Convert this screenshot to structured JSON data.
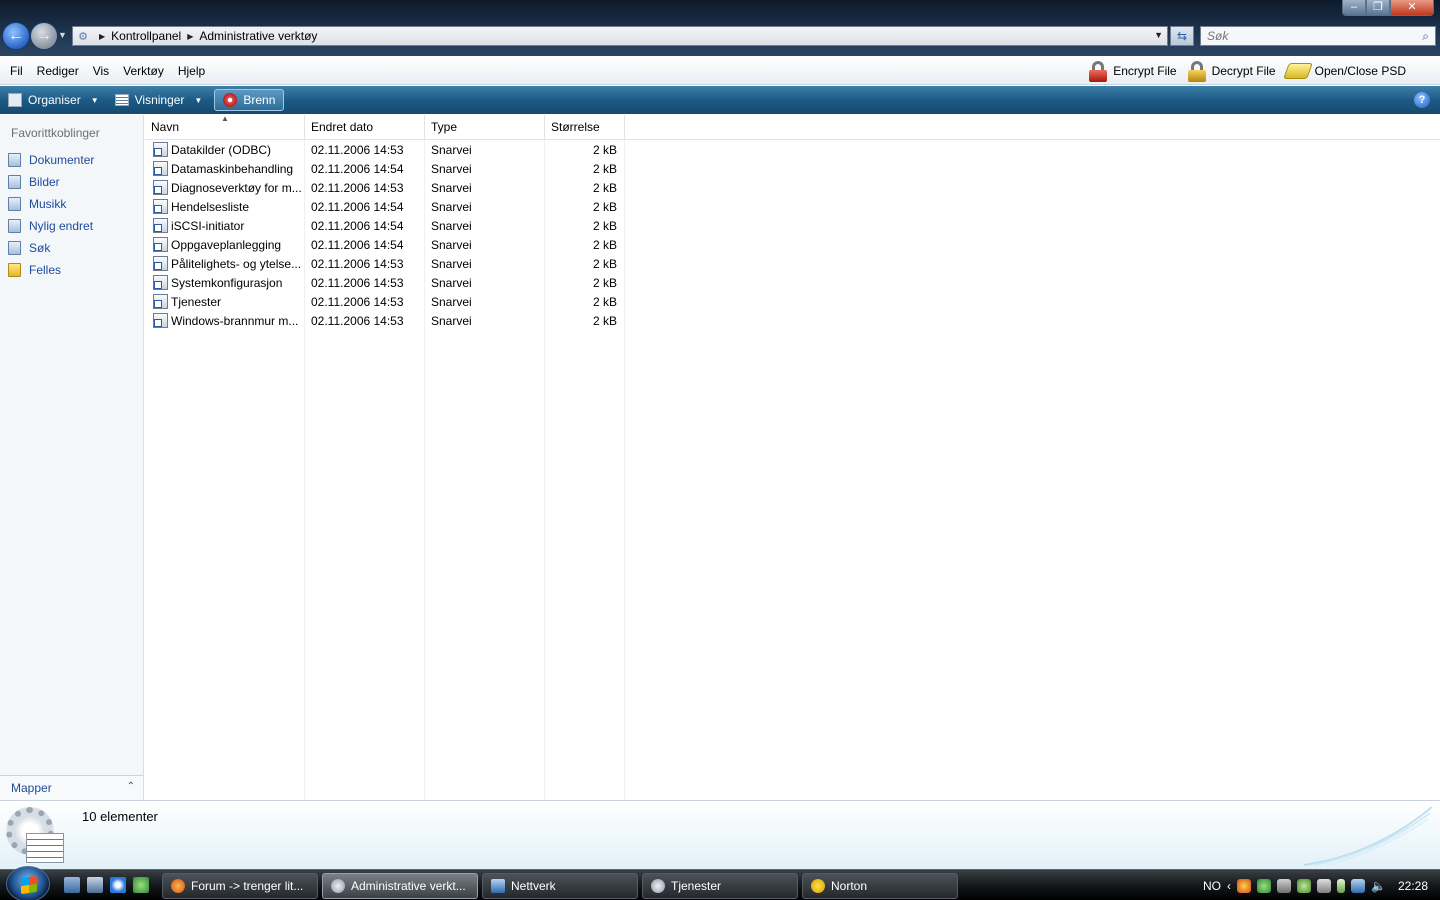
{
  "window": {
    "minimize": "‒",
    "maximize": "❐",
    "close": "✕"
  },
  "address": {
    "crumbs": [
      "Kontrollpanel",
      "Administrative verktøy"
    ]
  },
  "search": {
    "placeholder": "Søk"
  },
  "menu": {
    "items": [
      "Fil",
      "Rediger",
      "Vis",
      "Verktøy",
      "Hjelp"
    ],
    "tools": [
      "Encrypt File",
      "Decrypt File",
      "Open/Close PSD"
    ]
  },
  "commands": {
    "organise": "Organiser",
    "views": "Visninger",
    "burn": "Brenn"
  },
  "navpane": {
    "favorites_header": "Favorittkoblinger",
    "favorites": [
      "Dokumenter",
      "Bilder",
      "Musikk",
      "Nylig endret",
      "Søk",
      "Felles"
    ],
    "folders_label": "Mapper"
  },
  "columns": [
    "Navn",
    "Endret dato",
    "Type",
    "Størrelse"
  ],
  "files": [
    {
      "name": "Datakilder (ODBC)",
      "date": "02.11.2006 14:53",
      "type": "Snarvei",
      "size": "2 kB"
    },
    {
      "name": "Datamaskinbehandling",
      "date": "02.11.2006 14:54",
      "type": "Snarvei",
      "size": "2 kB"
    },
    {
      "name": "Diagnoseverktøy for m...",
      "date": "02.11.2006 14:53",
      "type": "Snarvei",
      "size": "2 kB"
    },
    {
      "name": "Hendelsesliste",
      "date": "02.11.2006 14:54",
      "type": "Snarvei",
      "size": "2 kB"
    },
    {
      "name": "iSCSI-initiator",
      "date": "02.11.2006 14:54",
      "type": "Snarvei",
      "size": "2 kB"
    },
    {
      "name": "Oppgaveplanlegging",
      "date": "02.11.2006 14:54",
      "type": "Snarvei",
      "size": "2 kB"
    },
    {
      "name": "Pålitelighets- og ytelse...",
      "date": "02.11.2006 14:53",
      "type": "Snarvei",
      "size": "2 kB"
    },
    {
      "name": "Systemkonfigurasjon",
      "date": "02.11.2006 14:53",
      "type": "Snarvei",
      "size": "2 kB"
    },
    {
      "name": "Tjenester",
      "date": "02.11.2006 14:53",
      "type": "Snarvei",
      "size": "2 kB"
    },
    {
      "name": "Windows-brannmur m...",
      "date": "02.11.2006 14:53",
      "type": "Snarvei",
      "size": "2 kB"
    }
  ],
  "details": {
    "count": "10 elementer"
  },
  "taskbar": {
    "tasks": [
      "Forum -> trenger lit...",
      "Administrative verkt...",
      "Nettverk",
      "Tjenester",
      "Norton"
    ],
    "language": "NO",
    "clock": "22:28"
  }
}
